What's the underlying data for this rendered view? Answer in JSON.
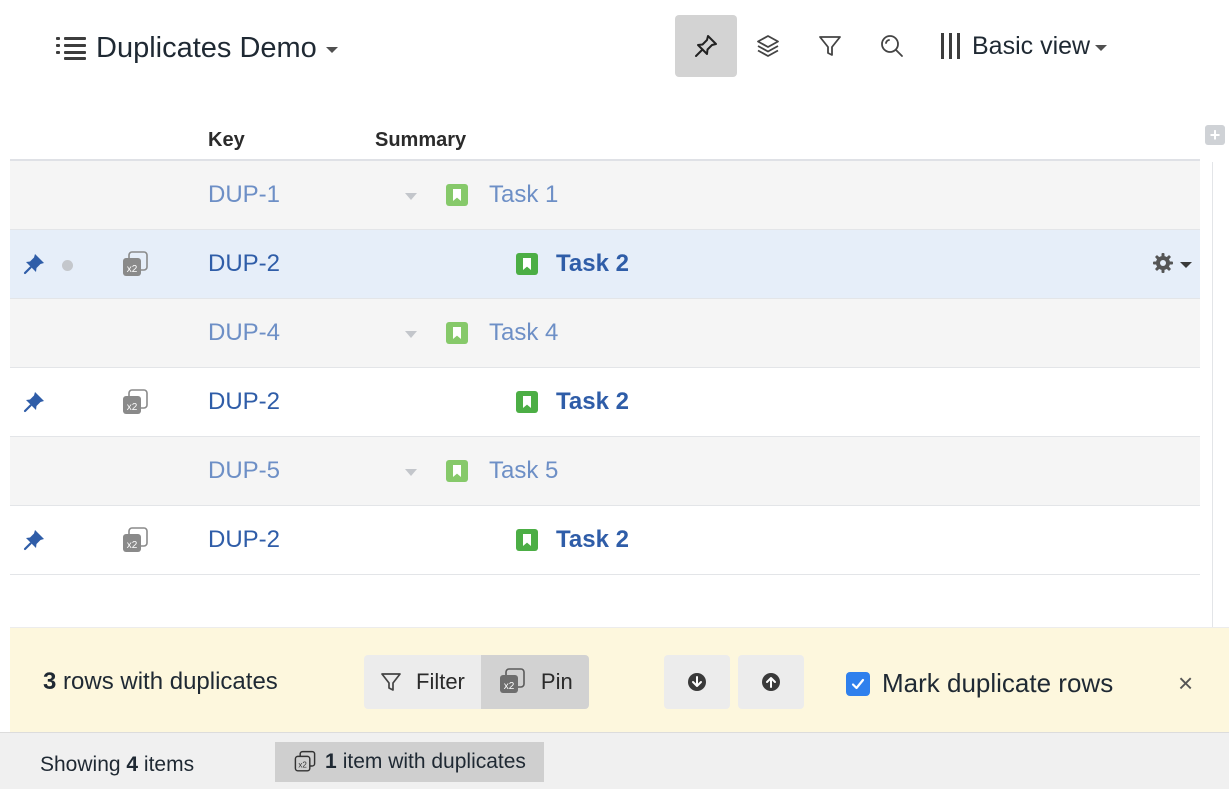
{
  "header": {
    "title": "Duplicates Demo",
    "view_label": "Basic view",
    "toolbar_icons": [
      "pin-icon",
      "layers-icon",
      "filter-icon",
      "search-icon",
      "columns-icon"
    ]
  },
  "table": {
    "columns": {
      "key": "Key",
      "summary": "Summary"
    },
    "rows": [
      {
        "key": "DUP-1",
        "summary": "Task 1",
        "type": "parent"
      },
      {
        "key": "DUP-2",
        "summary": "Task 2",
        "type": "duplicate",
        "selected": true
      },
      {
        "key": "DUP-4",
        "summary": "Task 4",
        "type": "parent"
      },
      {
        "key": "DUP-2",
        "summary": "Task 2",
        "type": "duplicate"
      },
      {
        "key": "DUP-5",
        "summary": "Task 5",
        "type": "parent"
      },
      {
        "key": "DUP-2",
        "summary": "Task 2",
        "type": "duplicate"
      }
    ]
  },
  "banner": {
    "count": "3",
    "text": " rows with duplicates",
    "filter_label": "Filter",
    "pin_label": "Pin",
    "mark_label": "Mark duplicate rows",
    "mark_checked": true,
    "close": "×"
  },
  "status": {
    "showing_prefix": "Showing ",
    "showing_count": "4",
    "showing_suffix": " items",
    "dup_count": "1",
    "dup_text": "item with duplicates"
  },
  "colors": {
    "link_light": "#6d8fc6",
    "link_dark": "#2f5da8",
    "story_green": "#4cae45",
    "banner_bg": "#fdf7dd",
    "checkbox_blue": "#2f80ed"
  }
}
